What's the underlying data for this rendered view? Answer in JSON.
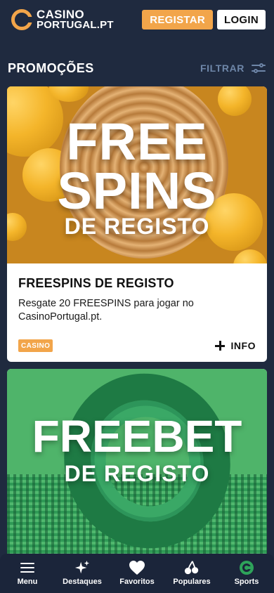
{
  "header": {
    "logo_line1": "CASINO",
    "logo_line2": "PORTUGAL.PT",
    "register_label": "REGISTAR",
    "login_label": "LOGIN"
  },
  "section": {
    "title": "PROMOÇÕES",
    "filter_label": "FILTRAR"
  },
  "promos": [
    {
      "banner_line1": "FREE",
      "banner_line2": "SPINS",
      "banner_line3": "DE REGISTO",
      "title": "FREESPINS DE REGISTO",
      "description": "Resgate 20 FREESPINS para jogar no CasinoPortugal.pt.",
      "tag": "CASINO",
      "info_label": "INFO"
    },
    {
      "banner_line1": "FREEBET",
      "banner_line2": "DE REGISTO"
    }
  ],
  "bottom_nav": [
    {
      "label": "Menu",
      "icon": "menu-icon"
    },
    {
      "label": "Destaques",
      "icon": "sparkle-icon"
    },
    {
      "label": "Favoritos",
      "icon": "heart-icon"
    },
    {
      "label": "Populares",
      "icon": "cherries-icon"
    },
    {
      "label": "Sports",
      "icon": "sports-logo-icon"
    }
  ],
  "colors": {
    "background": "#1f2a3f",
    "accent_orange": "#f2a54a",
    "filter_blue": "#6e86a8",
    "sports_green": "#2ea35a"
  }
}
